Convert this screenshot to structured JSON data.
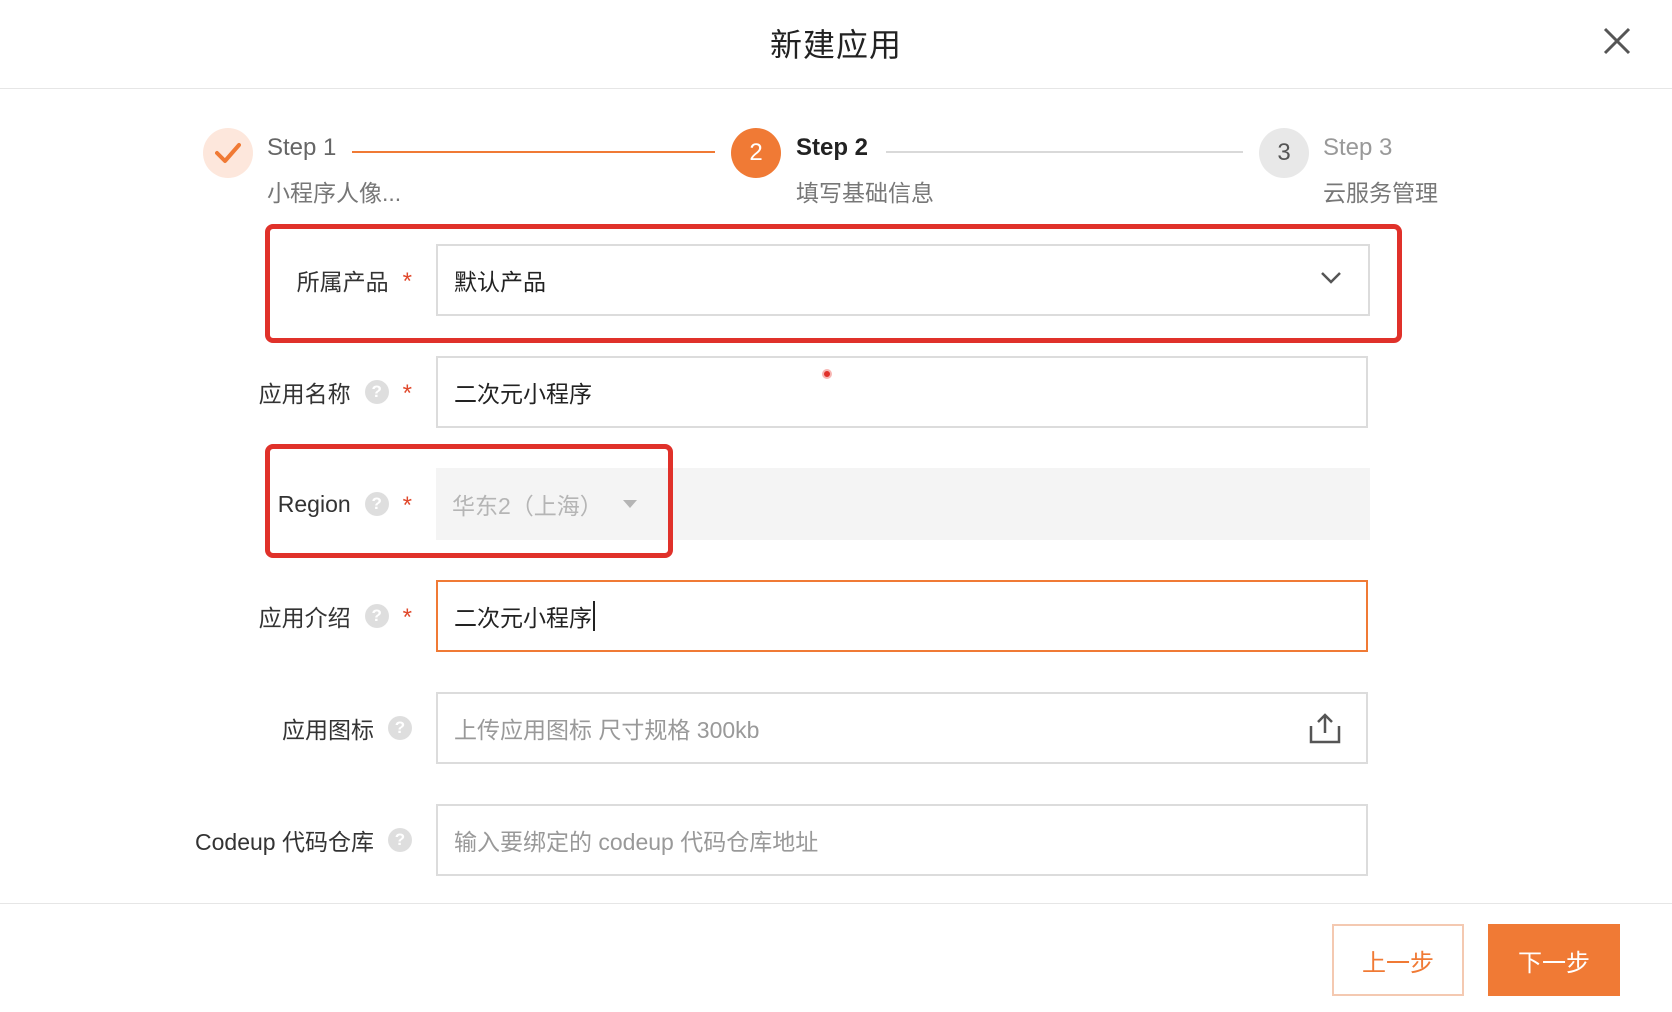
{
  "dialog": {
    "title": "新建应用"
  },
  "steps": [
    {
      "index": "1",
      "title": "Step 1",
      "description": "小程序人像...",
      "status": "done"
    },
    {
      "index": "2",
      "title": "Step 2",
      "description": "填写基础信息",
      "status": "active"
    },
    {
      "index": "3",
      "title": "Step 3",
      "description": "云服务管理",
      "status": "wait"
    }
  ],
  "form": {
    "product": {
      "label": "所属产品",
      "required": "*",
      "value": "默认产品"
    },
    "app_name": {
      "label": "应用名称",
      "help": "?",
      "required": "*",
      "value": "二次元小程序"
    },
    "region": {
      "label": "Region",
      "help": "?",
      "required": "*",
      "value": "华东2（上海）"
    },
    "app_intro": {
      "label": "应用介绍",
      "help": "?",
      "required": "*",
      "value": "二次元小程序"
    },
    "app_icon": {
      "label": "应用图标",
      "help": "?",
      "placeholder": "上传应用图标 尺寸规格 300kb"
    },
    "codeup": {
      "label": "Codeup 代码仓库",
      "help": "?",
      "placeholder": "输入要绑定的 codeup 代码仓库地址"
    }
  },
  "footer": {
    "prev_label": "上一步",
    "next_label": "下一步"
  },
  "colors": {
    "accent": "#f07a35",
    "required": "#e0482b",
    "annotation": "#e0312a"
  }
}
